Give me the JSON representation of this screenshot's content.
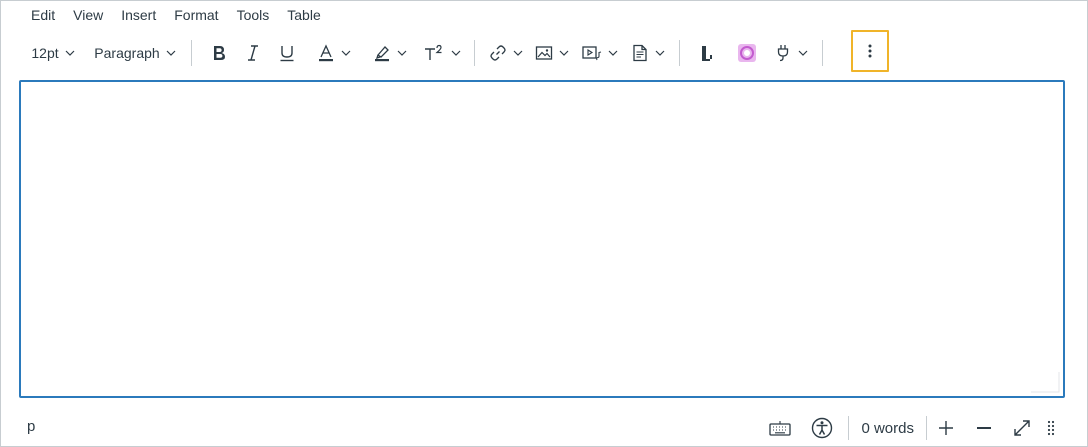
{
  "menubar": {
    "items": [
      {
        "label": "Edit"
      },
      {
        "label": "View"
      },
      {
        "label": "Insert"
      },
      {
        "label": "Format"
      },
      {
        "label": "Tools"
      },
      {
        "label": "Table"
      }
    ]
  },
  "toolbar": {
    "font_size": "12pt",
    "block_format": "Paragraph",
    "icons": [
      "bold-icon",
      "italic-icon",
      "underline-icon",
      "text-color-icon",
      "highlight-icon",
      "superscript-icon",
      "link-icon",
      "image-icon",
      "media-icon",
      "document-icon",
      "equation-icon",
      "app-icon",
      "plugin-icon",
      "more-vertical-icon"
    ],
    "more_highlight_color": "#f0b429"
  },
  "editor": {
    "border_color": "#2b7abc"
  },
  "statusbar": {
    "path": "p",
    "word_count": "0 words"
  }
}
